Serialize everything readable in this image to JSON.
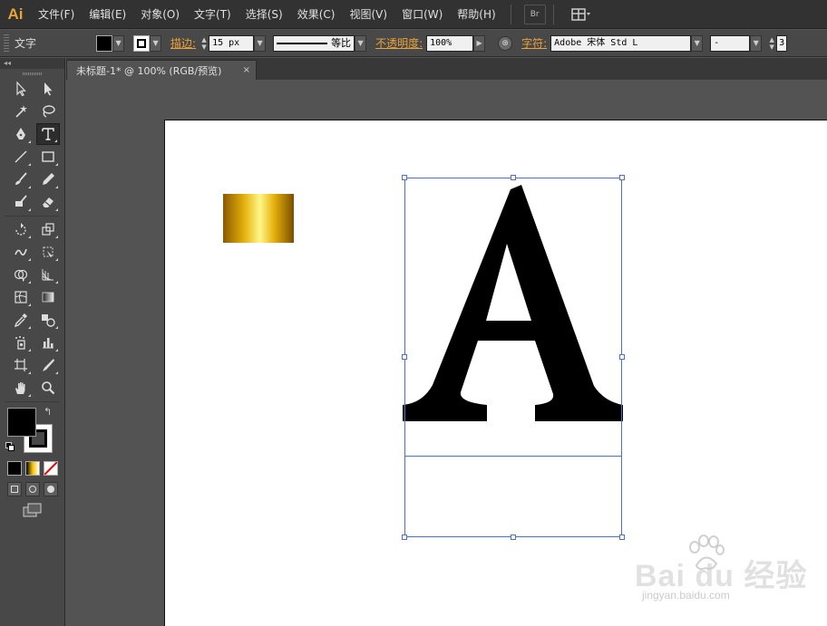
{
  "app": {
    "logo": "Ai",
    "menu": [
      "文件(F)",
      "编辑(E)",
      "对象(O)",
      "文字(T)",
      "选择(S)",
      "效果(C)",
      "视图(V)",
      "窗口(W)",
      "帮助(H)"
    ],
    "bridge_label": "Br"
  },
  "control": {
    "tool_name": "文字",
    "stroke_label": "描边:",
    "stroke_value": "15 px",
    "stroke_profile": "等比",
    "opacity_label": "不透明度:",
    "opacity_value": "100%",
    "char_label": "字符:",
    "font_family": "Adobe 宋体 Std L",
    "font_style": "-",
    "extra": "3"
  },
  "toolpanel": {
    "collapse_label": "◂◂"
  },
  "document": {
    "tab_title": "未标题-1* @ 100% (RGB/预览)",
    "close_label": "×",
    "text_content": "A"
  },
  "watermark": {
    "brand": "Bai du 经验",
    "url": "jingyan.baidu.com"
  },
  "colors": {
    "fill": "#000000",
    "stroke": "#000000",
    "selection": "#4a6fd8",
    "accent": "#e8a33b"
  }
}
